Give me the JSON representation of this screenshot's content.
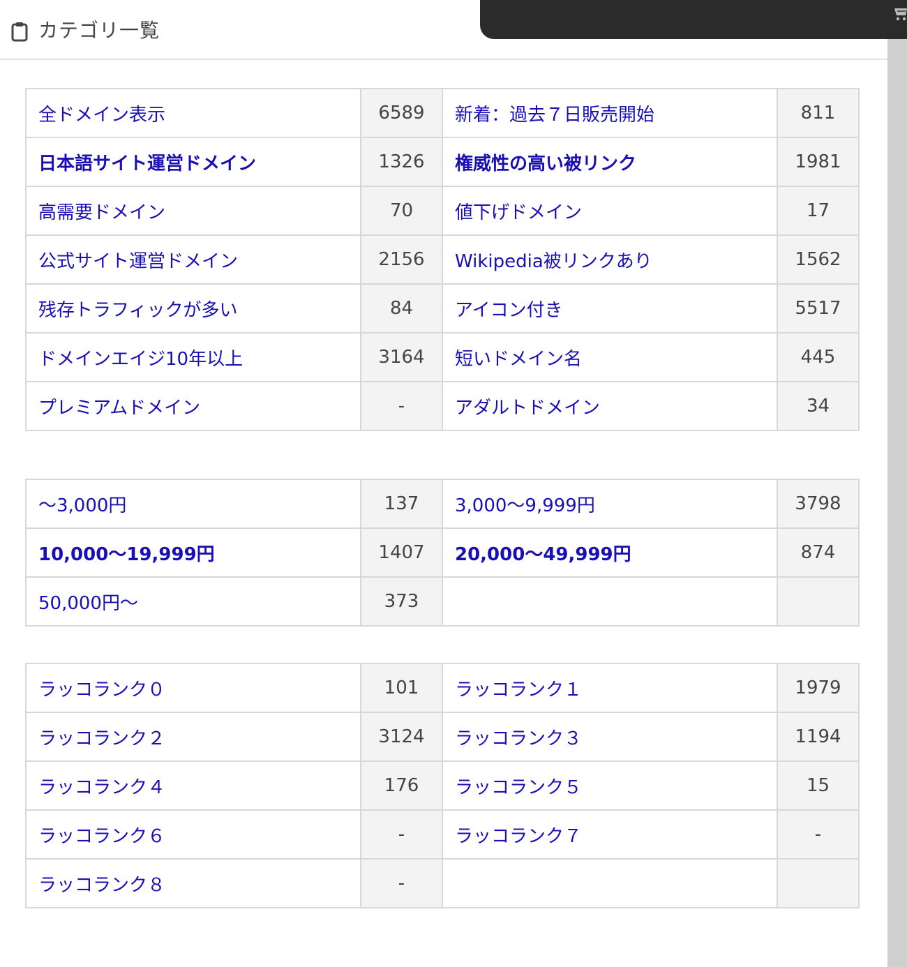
{
  "header": {
    "title": "カテゴリ一覧",
    "icon": "clipboard-icon"
  },
  "topbar": {
    "icon": "cart-icon"
  },
  "colors": {
    "link": "#1a0fb5",
    "count_bg": "#f3f3f3",
    "border": "#d8d8d8",
    "topbar": "#2b2b2b"
  },
  "tables": {
    "features": [
      {
        "left": {
          "label": "全ドメイン表示",
          "count": "6589"
        },
        "right": {
          "label": "新着：過去７日販売開始",
          "count": "811"
        }
      },
      {
        "left": {
          "label": "日本語サイト運営ドメイン",
          "count": "1326"
        },
        "right": {
          "label": "権威性の高い被リンク",
          "count": "1981"
        }
      },
      {
        "left": {
          "label": "高需要ドメイン",
          "count": "70"
        },
        "right": {
          "label": "値下げドメイン",
          "count": "17"
        }
      },
      {
        "left": {
          "label": "公式サイト運営ドメイン",
          "count": "2156"
        },
        "right": {
          "label": "Wikipedia被リンクあり",
          "count": "1562"
        }
      },
      {
        "left": {
          "label": "残存トラフィックが多い",
          "count": "84"
        },
        "right": {
          "label": "アイコン付き",
          "count": "5517"
        }
      },
      {
        "left": {
          "label": "ドメインエイジ10年以上",
          "count": "3164"
        },
        "right": {
          "label": "短いドメイン名",
          "count": "445"
        }
      },
      {
        "left": {
          "label": "プレミアムドメイン",
          "count": "-"
        },
        "right": {
          "label": "アダルトドメイン",
          "count": "34"
        }
      }
    ],
    "price": [
      {
        "left": {
          "label": "〜3,000円",
          "count": "137"
        },
        "right": {
          "label": "3,000〜9,999円",
          "count": "3798"
        }
      },
      {
        "left": {
          "label": "10,000〜19,999円",
          "count": "1407"
        },
        "right": {
          "label": "20,000〜49,999円",
          "count": "874"
        }
      },
      {
        "left": {
          "label": "50,000円〜",
          "count": "373"
        }
      }
    ],
    "rank": [
      {
        "left": {
          "label": "ラッコランク０",
          "count": "101"
        },
        "right": {
          "label": "ラッコランク１",
          "count": "1979"
        }
      },
      {
        "left": {
          "label": "ラッコランク２",
          "count": "3124"
        },
        "right": {
          "label": "ラッコランク３",
          "count": "1194"
        }
      },
      {
        "left": {
          "label": "ラッコランク４",
          "count": "176"
        },
        "right": {
          "label": "ラッコランク５",
          "count": "15"
        }
      },
      {
        "left": {
          "label": "ラッコランク６",
          "count": "-"
        },
        "right": {
          "label": "ラッコランク７",
          "count": "-"
        }
      },
      {
        "left": {
          "label": "ラッコランク８",
          "count": "-"
        }
      }
    ]
  }
}
